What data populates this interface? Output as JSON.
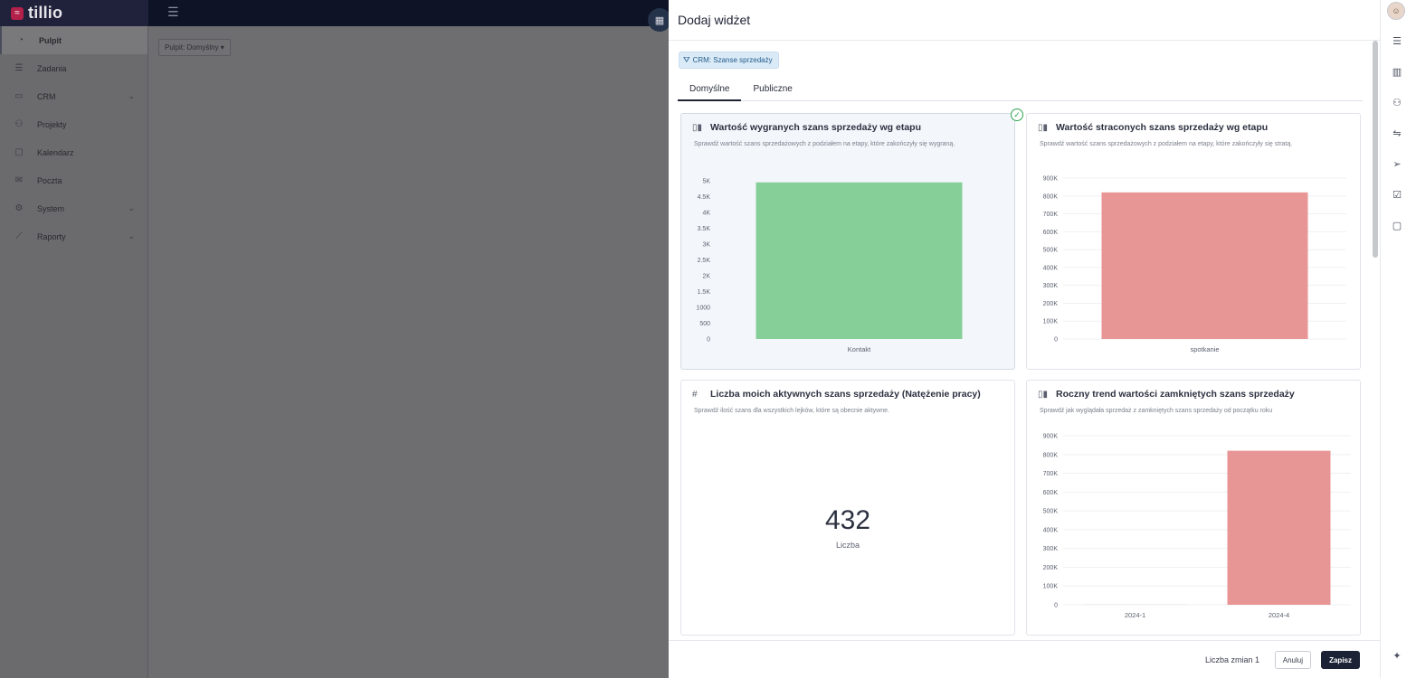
{
  "app": {
    "logo": "tillio",
    "logo_mark": "≈"
  },
  "sidebar": {
    "items": [
      {
        "label": "Pulpit",
        "icon": "gauge-icon",
        "active": true
      },
      {
        "label": "Zadania",
        "icon": "tasks-icon"
      },
      {
        "label": "CRM",
        "icon": "crm-icon",
        "expandable": true
      },
      {
        "label": "Projekty",
        "icon": "projects-icon"
      },
      {
        "label": "Kalendarz",
        "icon": "calendar-icon"
      },
      {
        "label": "Poczta",
        "icon": "mail-icon"
      },
      {
        "label": "System",
        "icon": "gear-icon",
        "expandable": true
      },
      {
        "label": "Raporty",
        "icon": "chart-line-icon",
        "expandable": true
      }
    ]
  },
  "dashboard": {
    "selector_label": "Pulpit: Domyślny ▾"
  },
  "panel": {
    "title": "Dodaj widżet",
    "filter_chip": "CRM: Szanse sprzedaży",
    "tabs": [
      {
        "label": "Domyślne",
        "active": true
      },
      {
        "label": "Publiczne"
      }
    ],
    "footer": {
      "changes": "Liczba zmian 1",
      "cancel": "Anuluj",
      "save": "Zapisz"
    }
  },
  "widgets": [
    {
      "title": "Wartość wygranych szans sprzedaży wg etapu",
      "description": "Sprawdź wartość szans sprzedażowych z podziałem na etapy, które zakończyły się wygraną.",
      "icon": "bar-chart-icon",
      "selected": true
    },
    {
      "title": "Wartość straconych szans sprzedaży wg etapu",
      "description": "Sprawdź wartość szans sprzedażowych z podziałem na etapy, które zakończyły się stratą.",
      "icon": "bar-chart-icon"
    },
    {
      "title": "Liczba moich aktywnych szans sprzedaży (Natężenie pracy)",
      "description": "Sprawdź ilość szans dla wszystkich lejków, które są obecnie aktywne.",
      "icon": "hash-icon",
      "kpi_value": "432",
      "kpi_label": "Liczba"
    },
    {
      "title": "Roczny trend wartości zamkniętych szans sprzedaży",
      "description": "Sprawdź jak wyglądała sprzedaż z zamkniętych szans sprzedaży od początku roku",
      "icon": "bar-chart-icon"
    }
  ],
  "chart_data": [
    {
      "type": "bar",
      "categories": [
        "Kontakt"
      ],
      "values": [
        4950
      ],
      "yticks": [
        "0",
        "500",
        "1000",
        "1.5K",
        "2K",
        "2.5K",
        "3K",
        "3.5K",
        "4K",
        "4.5K",
        "5K"
      ],
      "ylim": [
        0,
        5000
      ],
      "color": "#86cf98",
      "grid": false
    },
    {
      "type": "bar",
      "categories": [
        "spotkanie"
      ],
      "values": [
        820000
      ],
      "yticks": [
        "0",
        "100K",
        "200K",
        "300K",
        "400K",
        "500K",
        "600K",
        "700K",
        "800K",
        "900K"
      ],
      "ylim": [
        0,
        900000
      ],
      "color": "#e89595",
      "grid": true
    },
    {
      "type": "bar",
      "categories": [
        "2024-1",
        "2024-4"
      ],
      "values": [
        0,
        820000
      ],
      "yticks": [
        "0",
        "100K",
        "200K",
        "300K",
        "400K",
        "500K",
        "600K",
        "700K",
        "800K",
        "900K"
      ],
      "ylim": [
        0,
        900000
      ],
      "color": "#e89595",
      "grid": true
    }
  ],
  "rail": {
    "icons": [
      "tasks-icon",
      "building-icon",
      "users-icon",
      "handshake-icon",
      "send-icon",
      "checklist-icon",
      "calendar-icon",
      "lightbulb-icon"
    ]
  }
}
